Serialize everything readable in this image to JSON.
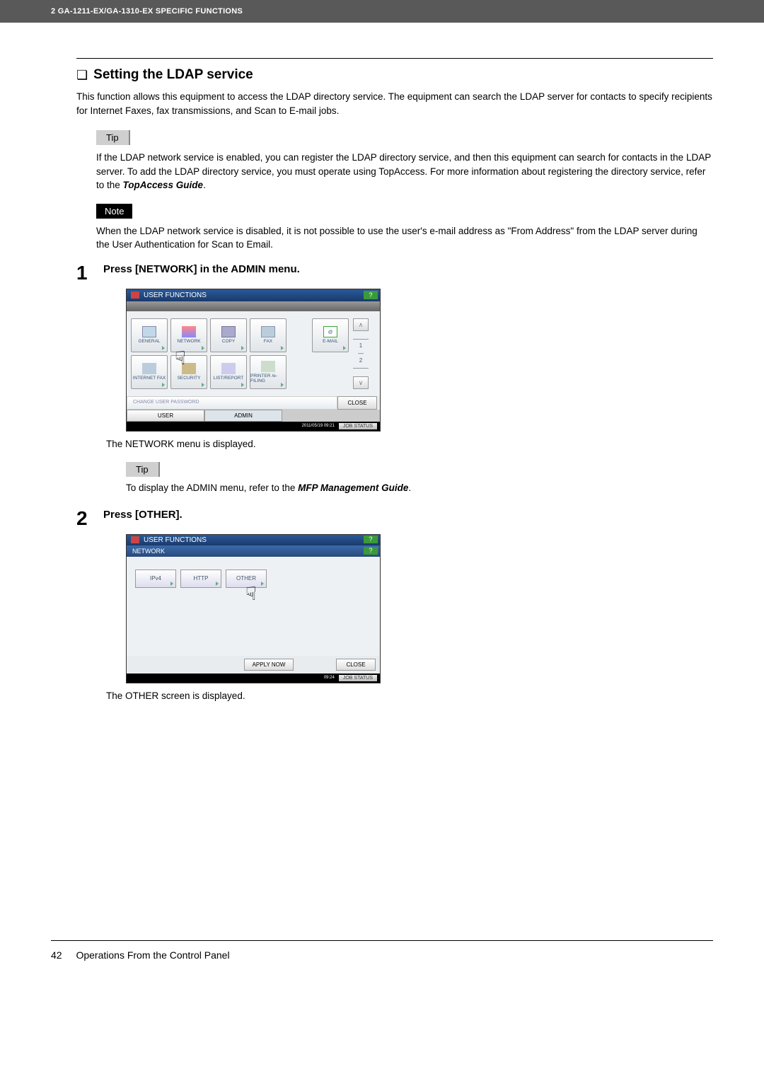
{
  "header": {
    "text": "2 GA-1211-EX/GA-1310-EX SPECIFIC FUNCTIONS"
  },
  "section": {
    "bullet": "❏",
    "title": "Setting the LDAP service",
    "intro": "This function allows this equipment to access the LDAP directory service. The equipment can search the LDAP server for contacts to specify recipients for Internet Faxes, fax transmissions, and Scan to E-mail jobs."
  },
  "tip1": {
    "label": "Tip",
    "text_before": "If the LDAP network service is enabled, you can register the LDAP directory service, and then this equipment can search for contacts in the LDAP server. To add the LDAP directory service, you must operate using TopAccess. For more information about registering the directory service, refer to the ",
    "text_bold": "TopAccess Guide",
    "text_after": "."
  },
  "note1": {
    "label": "Note",
    "text": "When the LDAP network service is disabled, it is not possible to use the user's e-mail address as \"From Address\" from the LDAP server during the User Authentication for Scan to Email."
  },
  "step1": {
    "num": "1",
    "title": "Press [NETWORK] in the ADMIN menu.",
    "after_text": "The NETWORK menu is displayed.",
    "tip_label": "Tip",
    "tip_before": "To display the ADMIN menu, refer to the ",
    "tip_bold": "MFP Management Guide",
    "tip_after": "."
  },
  "step2": {
    "num": "2",
    "title": "Press [OTHER].",
    "after_text": "The OTHER screen is displayed."
  },
  "screen1": {
    "title": "USER FUNCTIONS",
    "help": "?",
    "buttons": {
      "general": "GENERAL",
      "network": "NETWORK",
      "copy": "COPY",
      "fax": "FAX",
      "email": "E-MAIL",
      "internet_fax": "INTERNET FAX",
      "security": "SECURITY",
      "list_report": "LIST/REPORT",
      "printer_efiling": "PRINTER /e-FILING"
    },
    "page_indicator": {
      "current": "1",
      "total": "2"
    },
    "change_pwd": "CHANGE USER PASSWORD",
    "close": "CLOSE",
    "tabs": {
      "user": "USER",
      "admin": "ADMIN"
    },
    "timestamp": "2011/05/19 09:21",
    "job_status": "JOB STATUS"
  },
  "screen2": {
    "title": "USER FUNCTIONS",
    "subtitle": "NETWORK",
    "help": "?",
    "buttons": {
      "ipv4": "IPv4",
      "http": "HTTP",
      "other": "OTHER"
    },
    "apply_now": "APPLY NOW",
    "close": "CLOSE",
    "timestamp": "09:24",
    "job_status": "JOB STATUS"
  },
  "footer": {
    "page": "42",
    "text": "Operations From the Control Panel"
  }
}
